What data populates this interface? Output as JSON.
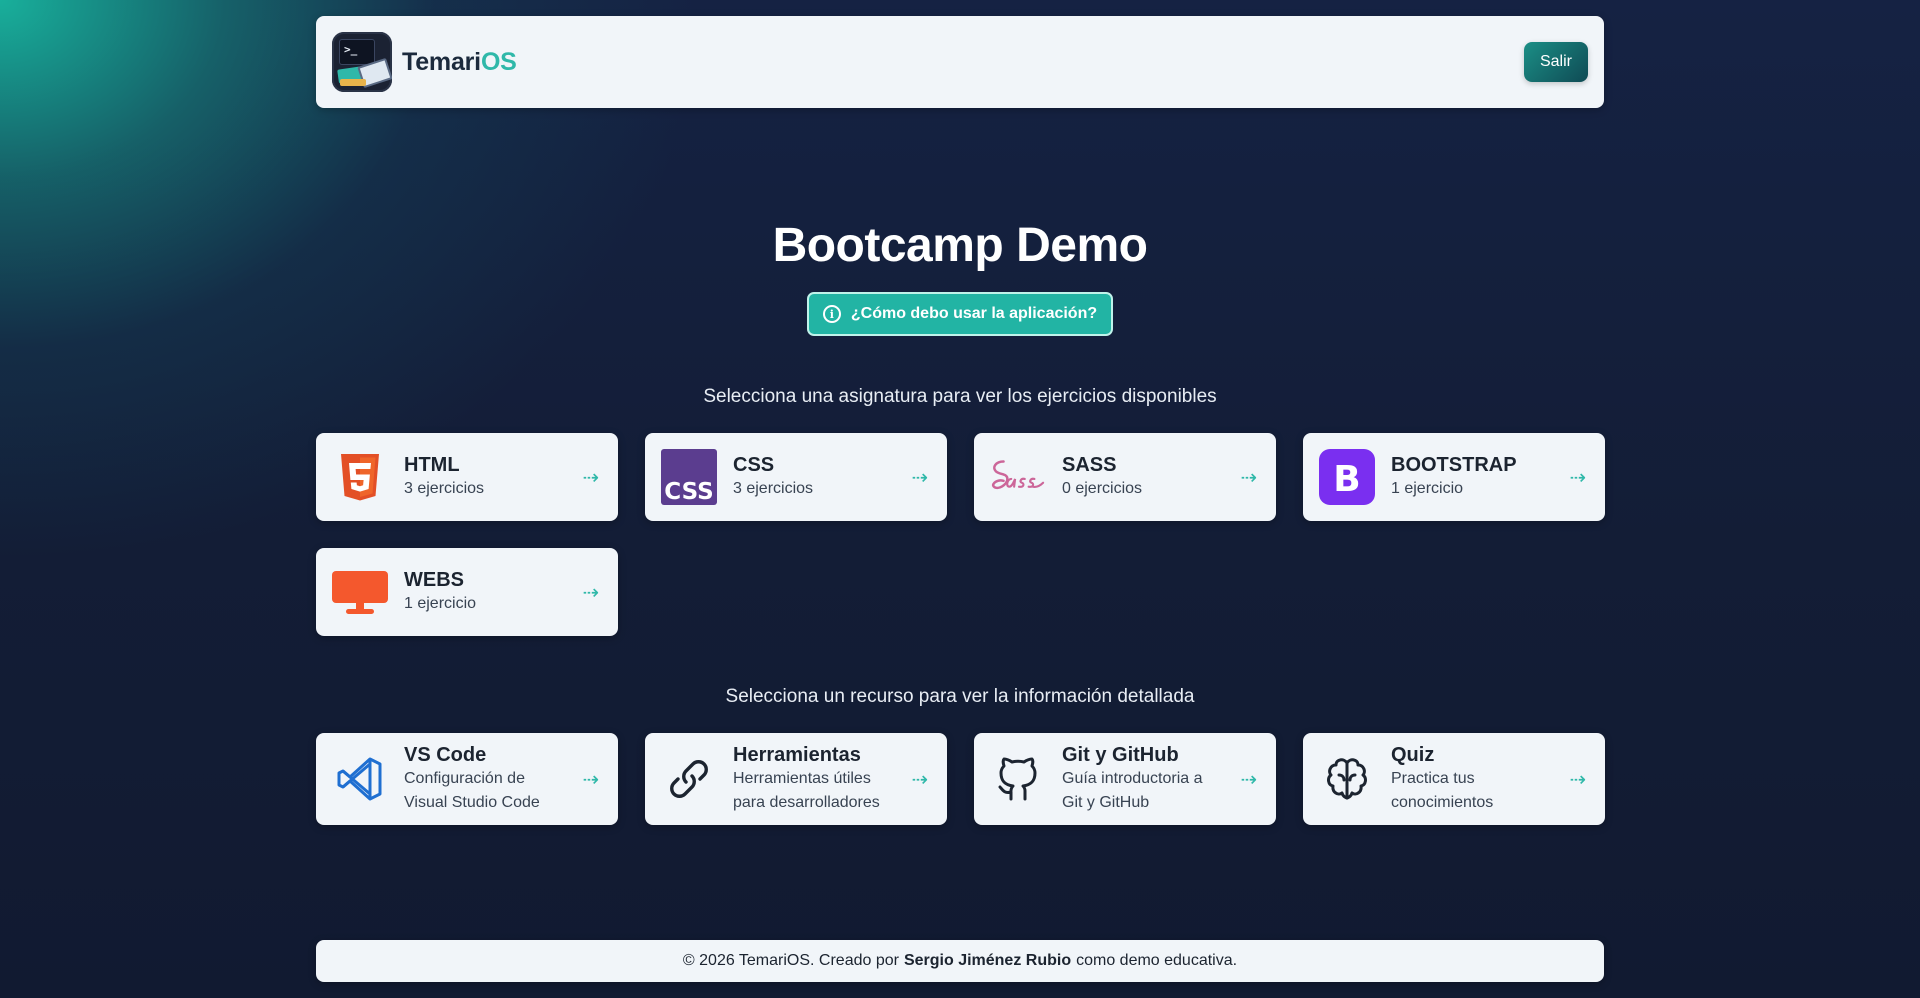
{
  "header": {
    "brand_prefix": "Temari",
    "brand_suffix": "OS",
    "logout_label": "Salir"
  },
  "hero": {
    "title": "Bootcamp Demo",
    "help_label": "¿Cómo debo usar la aplicación?"
  },
  "subjects": {
    "section_label": "Selecciona una asignatura para ver los ejercicios disponibles",
    "items": [
      {
        "name": "HTML",
        "count": "3 ejercicios",
        "icon": "html5-icon",
        "color": "#e34f26"
      },
      {
        "name": "CSS",
        "count": "3 ejercicios",
        "icon": "css-icon",
        "color": "#5b3d8f"
      },
      {
        "name": "SASS",
        "count": "0 ejercicios",
        "icon": "sass-icon",
        "color": "#cc6699"
      },
      {
        "name": "BOOTSTRAP",
        "count": "1 ejercicio",
        "icon": "bootstrap-icon",
        "color": "#7952b3"
      },
      {
        "name": "WEBS",
        "count": "1 ejercicio",
        "icon": "monitor-icon",
        "color": "#f4582d"
      }
    ]
  },
  "resources": {
    "section_label": "Selecciona un recurso para ver la información detallada",
    "items": [
      {
        "name": "VS Code",
        "desc_line1": "Configuración de",
        "desc_line2": "Visual Studio Code",
        "icon": "vscode-icon",
        "color": "#1f6fd1"
      },
      {
        "name": "Herramientas",
        "desc_line1": "Herramientas útiles",
        "desc_line2": "para desarrolladores",
        "icon": "link-icon",
        "color": "#1c2430"
      },
      {
        "name": "Git y GitHub",
        "desc_line1": "Guía introductoria a",
        "desc_line2": "Git y GitHub",
        "icon": "github-icon",
        "color": "#1c2430"
      },
      {
        "name": "Quiz",
        "desc_line1": "Practica tus",
        "desc_line2": "conocimientos",
        "icon": "brain-icon",
        "color": "#1c2430"
      }
    ]
  },
  "footer": {
    "prefix": "© 2026 TemariOS. Creado por",
    "author": "Sergio Jiménez Rubio",
    "suffix": "como demo educativa."
  },
  "colors": {
    "accent": "#2fb8a9",
    "background": "#131d36",
    "card": "#f1f5f9"
  }
}
